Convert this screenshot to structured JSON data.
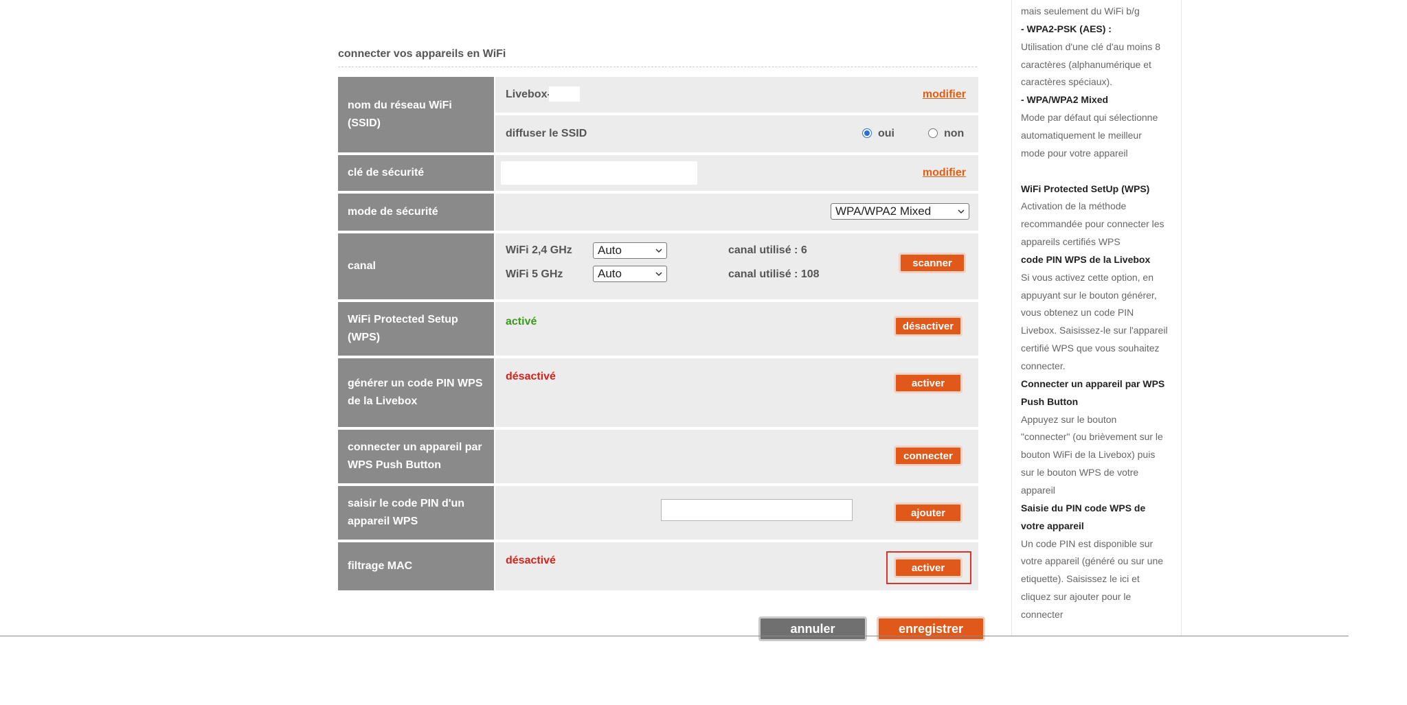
{
  "section": {
    "title": "connecter vos appareils en WiFi"
  },
  "ssid": {
    "label_line1": "nom du réseau WiFi",
    "label_line2": "(SSID)",
    "value": "Livebox-",
    "modify": "modifier",
    "broadcast_label": "diffuser le SSID",
    "yes": "oui",
    "no": "non"
  },
  "security_key": {
    "label": "clé de sécurité",
    "modify": "modifier"
  },
  "security_mode": {
    "label": "mode de sécurité",
    "value": "WPA/WPA2 Mixed"
  },
  "channel": {
    "label": "canal",
    "band24": "WiFi 2,4 GHz",
    "band5": "WiFi 5 GHz",
    "select24": "Auto",
    "select5": "Auto",
    "used24": "canal utilisé : 6",
    "used5": "canal utilisé : 108",
    "scan": "scanner"
  },
  "wps": {
    "label_line1": "WiFi Protected Setup",
    "label_line2": "(WPS)",
    "status": "activé",
    "button": "désactiver"
  },
  "wps_pin": {
    "label_line1": "générer un code PIN WPS",
    "label_line2": "de la Livebox",
    "status": "désactivé",
    "button": "activer"
  },
  "wps_push": {
    "label_line1": "connecter un appareil par",
    "label_line2": "WPS Push Button",
    "button": "connecter"
  },
  "wps_enter_pin": {
    "label_line1": "saisir le code PIN d'un",
    "label_line2": "appareil WPS",
    "button": "ajouter"
  },
  "mac_filter": {
    "label": "filtrage MAC",
    "status": "désactivé",
    "button": "activer"
  },
  "footer": {
    "cancel": "annuler",
    "save": "enregistrer"
  },
  "help": {
    "lines": [
      {
        "text": "mais seulement du WiFi b/g",
        "bold": false
      },
      {
        "text": "- WPA2-PSK (AES) :",
        "bold": true
      },
      {
        "text": "Utilisation d'une clé d'au moins 8",
        "bold": false
      },
      {
        "text": "caractères (alphanumérique et",
        "bold": false
      },
      {
        "text": "caractères spéciaux).",
        "bold": false
      },
      {
        "text": "- WPA/WPA2 Mixed",
        "bold": true
      },
      {
        "text": "Mode par défaut qui sélectionne",
        "bold": false
      },
      {
        "text": "automatiquement le meilleur",
        "bold": false
      },
      {
        "text": "mode pour votre appareil",
        "bold": false
      },
      {
        "text": "",
        "bold": false
      },
      {
        "text": "WiFi Protected SetUp (WPS)",
        "bold": true
      },
      {
        "text": "Activation de la méthode",
        "bold": false
      },
      {
        "text": "recommandée pour connecter les",
        "bold": false
      },
      {
        "text": "appareils certifiés WPS",
        "bold": false
      },
      {
        "text": "code PIN WPS de la Livebox",
        "bold": true
      },
      {
        "text": "Si vous activez cette option, en",
        "bold": false
      },
      {
        "text": "appuyant sur le bouton générer,",
        "bold": false
      },
      {
        "text": "vous obtenez un code PIN",
        "bold": false
      },
      {
        "text": "Livebox. Saisissez-le sur l'appareil",
        "bold": false
      },
      {
        "text": "certifié WPS que vous souhaitez",
        "bold": false
      },
      {
        "text": "connecter.",
        "bold": false
      },
      {
        "text": "Connecter un appareil par WPS",
        "bold": true
      },
      {
        "text": "Push Button",
        "bold": true
      },
      {
        "text": "Appuyez sur le bouton",
        "bold": false
      },
      {
        "text": "\"connecter\" (ou brièvement sur le",
        "bold": false
      },
      {
        "text": "bouton WiFi de la Livebox) puis",
        "bold": false
      },
      {
        "text": "sur le bouton WPS de votre",
        "bold": false
      },
      {
        "text": "appareil",
        "bold": false
      },
      {
        "text": "Saisie du PIN code WPS de",
        "bold": true
      },
      {
        "text": "votre appareil",
        "bold": true
      },
      {
        "text": "Un code PIN est disponible sur",
        "bold": false
      },
      {
        "text": "votre appareil (généré ou sur une",
        "bold": false
      },
      {
        "text": "etiquette). Saisissez le ici et",
        "bold": false
      },
      {
        "text": "cliquez sur ajouter pour le",
        "bold": false
      },
      {
        "text": "connecter",
        "bold": false
      }
    ]
  }
}
